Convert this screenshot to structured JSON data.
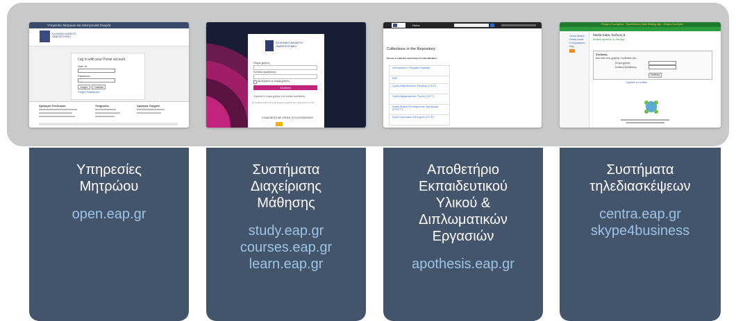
{
  "cards": [
    {
      "title": "Υπηρεσίες\nΜητρώου",
      "links": "open.eap.gr",
      "screenshot": {
        "header": "Υπηρεσίες Μητρώου και Ηλεκτρονικά Στοιχεία",
        "logo_text": "ΕΛΛΗΝΙΚΟ ΑΝΟΙΚΤΟ ΠΑΝΕΠΙΣΤΗΜΙΟ",
        "login_title": "Log in with your Portal account",
        "field1": "User ID",
        "field2": "Password",
        "btn1": "Login",
        "btn2": "Cancel",
        "forgot": "Forgot Password?",
        "footer_col1": "Χρήσιμοι Σύνδεσμοι",
        "footer_col2": "Υπηρεσίες",
        "footer_col3": "Χρήσιμα Στοιχεία"
      }
    },
    {
      "title": "Συστήματα\nΔιαχείρισης\nΜάθησης",
      "links": "study.eap.gr\ncourses.eap.gr\nlearn.eap.gr",
      "screenshot": {
        "logo_text": "ΕΛΛΗΝΙΚΟ ΑΝΟΙΚΤΟ ΠΑΝΕΠΙΣΤΗΜΙΟ",
        "field1": "Όνομα χρήστη",
        "field2": "Κωδικός πρόσβασης",
        "remember": "Να θυμάσαι το όνομα χρήστη",
        "button": "Σύνδεση",
        "forgot": "Ξεχάσατε το όνομα χρήστη ή τον κωδικό πρόσβασης;",
        "cookies": "Τα cookies πρέπει να είναι ενεργοποιημένα στον φυλλομετρητή σας",
        "footer": "ΣΥΝΔΕΘΕΙΤΕ ΜΕ ΧΡΗΣΗ ΤΟΥ ΛΟΓΑΡΙΑΣΜΟΥ"
      }
    },
    {
      "title": "Αποθετήριο\nΕκπαιδευτικού\nΥλικού &\nΔιπλωματικών\nΕργασιών",
      "links": "apothesis.eap.gr",
      "screenshot": {
        "nav_home": "Home",
        "heading": "Collections in the Repository",
        "subheading": "Choose a collection and browse its subcollections",
        "items": [
          "Διπλωματικές / Πτυχιακές Εργασίες",
          "ΕΑΠ",
          "Σχολή Ανθρωπιστικών Σπουδών (Σ.Α.Σ.)",
          "Σχολή Εφαρμοσμένων Τεχνών (Σ.Ε.Τ.)",
          "Σχολή Θετικών Επιστημών και Τεχνολογίας (Σ.Θ.Ε.Τ.)",
          "Σχολή Κοινωνικών Επιστημών (Σ.Κ.Ε.)"
        ]
      }
    },
    {
      "title": "Συστήματα\nτηλεδιασκέψεων",
      "links": "centra.eap.gr\nskype4business",
      "screenshot": {
        "topbar": "Έλεγχος Συστήματος · Εγκατάσταση Saba Meeting App · Οδηγός Συνεδρίας",
        "side_items": [
          "Centra Version",
          "Centra Locale",
          "Ο Λογαριασμός",
          "Help"
        ],
        "page_title": "Media Saba: Έκδοση 8",
        "link": "Βοήθεια σχετικά με το σύστημα",
        "box_title": "Σύνδεση",
        "box_text": "Εάν είστε νέος χρήστης, Συνδεθείτε εδώ",
        "field1": "Όνομα χρήστη:",
        "field2": "Κωδικός πρόσβασης:",
        "button": "Σύνδεση",
        "below": "Ξεχάσατε τον κωδικό;"
      }
    }
  ]
}
